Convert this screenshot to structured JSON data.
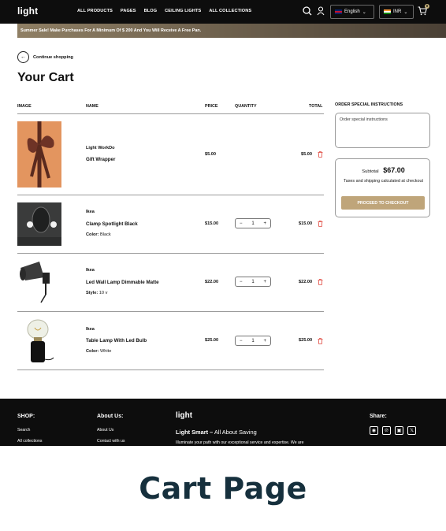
{
  "header": {
    "logo": "light",
    "nav": [
      "ALL PRODUCTS",
      "PAGES",
      "BLOG",
      "CEILING LIGHTS",
      "ALL COLLECTIONS"
    ],
    "language": "English",
    "currency": "INR",
    "cart_count": "0"
  },
  "announcement": "Summer Sale! Make Purchases For A Minimum Of $ 200 And You Will Receive A Free Pan.",
  "continue_label": "Continue shopping",
  "page_title": "Your Cart",
  "table": {
    "headers": [
      "IMAGE",
      "NAME",
      "PRICE",
      "QUANTITY",
      "TOTAL"
    ],
    "rows": [
      {
        "vendor": "Light WorkDo",
        "name": "Gift Wrapper",
        "variant_label": "",
        "variant_value": "",
        "price": "$5.00",
        "qty": "",
        "total": "$5.00"
      },
      {
        "vendor": "Ikea",
        "name": "Clamp Spotlight Black",
        "variant_label": "Color:",
        "variant_value": "Black",
        "price": "$15.00",
        "qty": "1",
        "total": "$15.00"
      },
      {
        "vendor": "Ikea",
        "name": "Led Wall Lamp Dimmable Matte",
        "variant_label": "Style:",
        "variant_value": "10 v",
        "price": "$22.00",
        "qty": "1",
        "total": "$22.00"
      },
      {
        "vendor": "Ikea",
        "name": "Table Lamp With Led Bulb",
        "variant_label": "Color:",
        "variant_value": "White",
        "price": "$25.00",
        "qty": "1",
        "total": "$25.00"
      }
    ]
  },
  "sidebar": {
    "instructions_title": "ORDER SPECIAL INSTRUCTIONS",
    "instructions_placeholder": "Order special instructions",
    "subtotal_label": "Subtotal",
    "subtotal_value": "$67.00",
    "tax_note": "Taxes and shipping calculated at checkout",
    "checkout_label": "PROCEED TO CHECKOUT"
  },
  "footer": {
    "shop_title": "SHOP:",
    "shop_links": [
      "Search",
      "All collections"
    ],
    "about_title": "About Us:",
    "about_links": [
      "About Us",
      "Contact with us"
    ],
    "logo": "light",
    "tagline_bold": "Light Smart –",
    "tagline_rest": "All About Saving",
    "description": "Illuminate your path with our exceptional service and expertise. We are",
    "share_title": "Share:"
  },
  "caption": "Cart Page",
  "colors": {
    "accent": "#bfa57a",
    "header_bg": "#0d0d0d",
    "delete": "#e0463c",
    "caption": "#16303d"
  }
}
